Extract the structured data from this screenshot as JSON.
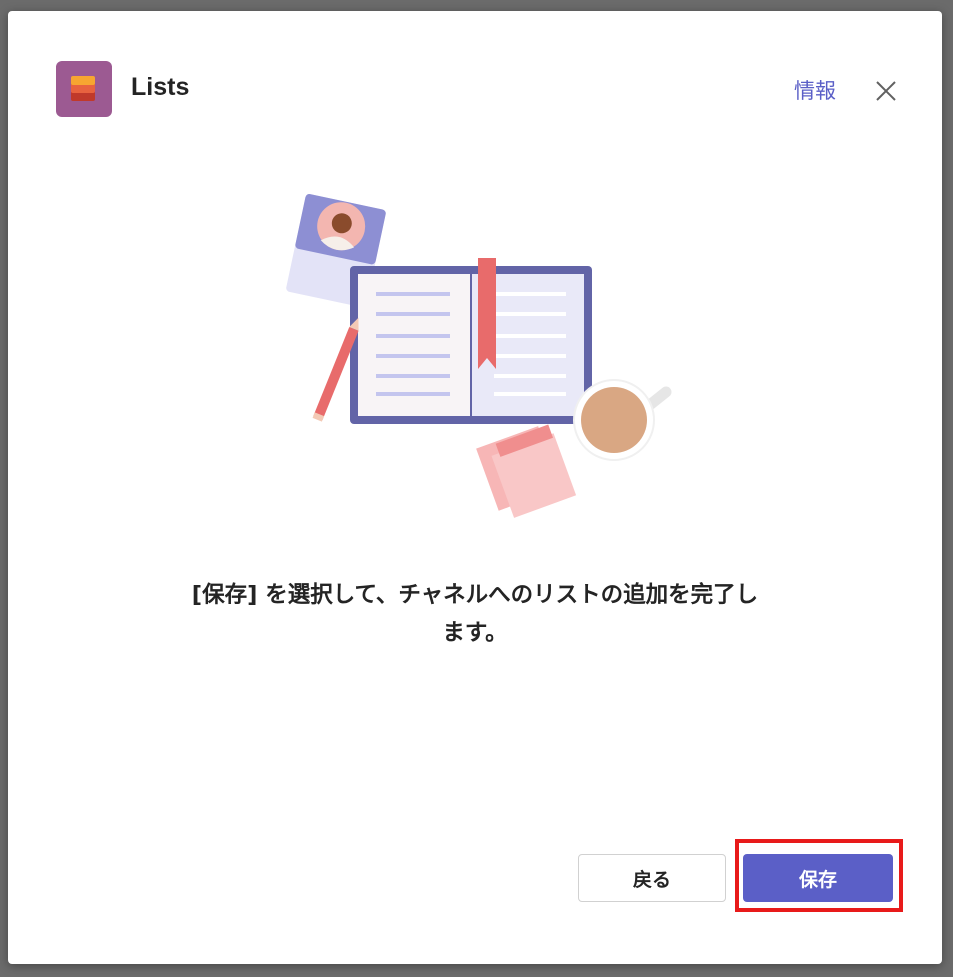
{
  "header": {
    "app_title": "Lists",
    "app_icon": "lists-app-icon",
    "info_label": "情報",
    "close_icon": "close-icon"
  },
  "illustration": {
    "icon": "open-book-illustration"
  },
  "main": {
    "message_line1": "[保存] を選択して、チャネルへのリストの追加を完了し",
    "message_line2": "ます。"
  },
  "footer": {
    "back_label": "戻る",
    "save_label": "保存"
  },
  "colors": {
    "accent": "#5b5fc7",
    "highlight": "#e81a1a",
    "app_icon_bg": "#9c5a92"
  }
}
